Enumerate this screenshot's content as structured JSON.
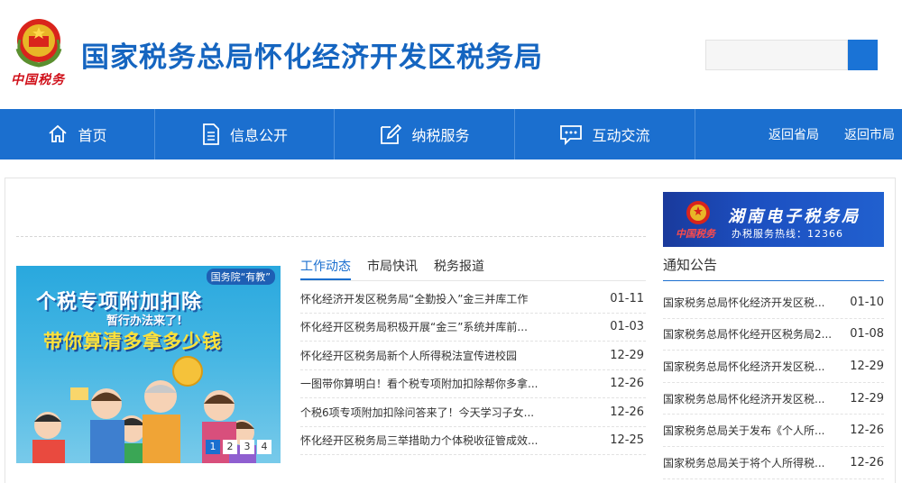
{
  "header": {
    "emblem_text": "中国税务",
    "title": "国家税务总局怀化经济开发区税务局",
    "search_placeholder": ""
  },
  "nav": {
    "items": [
      {
        "label": "首页",
        "icon": "home-icon"
      },
      {
        "label": "信息公开",
        "icon": "document-icon"
      },
      {
        "label": "纳税服务",
        "icon": "edit-icon"
      },
      {
        "label": "互动交流",
        "icon": "chat-icon"
      }
    ],
    "return_province": "返回省局",
    "return_city": "返回市局"
  },
  "slider": {
    "badge": "国务院“有教”",
    "line1": "个税专项附加扣除",
    "line2": "暂行办法来了!",
    "line3": "带你算清多拿多少钱",
    "pages": [
      "1",
      "2",
      "3",
      "4"
    ],
    "active_page": 1
  },
  "news": {
    "tabs": [
      "工作动态",
      "市局快讯",
      "税务报道"
    ],
    "active_tab": 0,
    "items": [
      {
        "title": "怀化经济开发区税务局“全勤投入”金三并库工作",
        "date": "01-11"
      },
      {
        "title": "怀化经开区税务局积极开展“金三”系统并库前...",
        "date": "01-03"
      },
      {
        "title": "怀化经开区税务局新个人所得税法宣传进校园",
        "date": "12-29"
      },
      {
        "title": "一图带你算明白！看个税专项附加扣除帮你多拿...",
        "date": "12-26"
      },
      {
        "title": "个税6项专项附加扣除问答来了！今天学习子女...",
        "date": "12-26"
      },
      {
        "title": "怀化经开区税务局三举措助力个体税收征管成效...",
        "date": "12-25"
      }
    ]
  },
  "banner": {
    "title": "湖南电子税务局",
    "hotline": "办税服务热线：12366",
    "logo_text": "中国税务"
  },
  "notices": {
    "title": "通知公告",
    "items": [
      {
        "title": "国家税务总局怀化经济开发区税...",
        "date": "01-10"
      },
      {
        "title": "国家税务总局怀化经开区税务局2...",
        "date": "01-08"
      },
      {
        "title": "国家税务总局怀化经济开发区税...",
        "date": "12-29"
      },
      {
        "title": "国家税务总局怀化经济开发区税...",
        "date": "12-29"
      },
      {
        "title": "国家税务总局关于发布《个人所...",
        "date": "12-26"
      },
      {
        "title": "国家税务总局关于将个人所得税...",
        "date": "12-26"
      }
    ]
  },
  "colors": {
    "brand_blue": "#1b6fcf",
    "title_blue": "#1565c0",
    "emblem_red": "#d0101a"
  }
}
